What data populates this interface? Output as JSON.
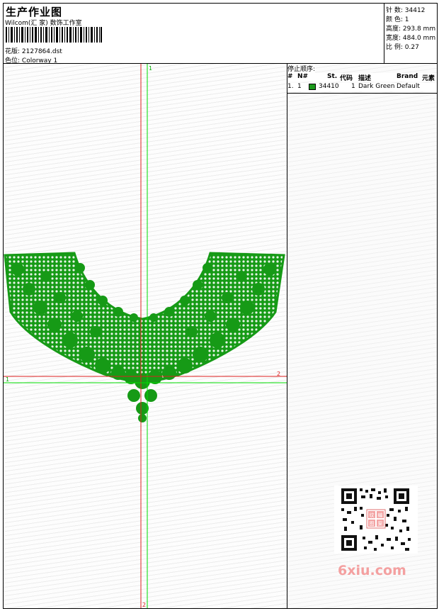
{
  "header": {
    "title": "生产作业图",
    "company": "Wilcom(汇 家) 数饰工作室",
    "design_label": "花版:",
    "design_value": "2127864.dst",
    "colorway_label": "色位:",
    "colorway_value": "Colorway 1"
  },
  "info": {
    "stitches_label": "针 数:",
    "stitches_value": "34412",
    "colors_label": "颜 色:",
    "colors_value": "1",
    "height_label": "高度:",
    "height_value": "293.8 mm",
    "width_label": "宽度:",
    "width_value": "484.0 mm",
    "scale_label": "比 例:",
    "scale_value": "0.27"
  },
  "stop_sequence": {
    "title": "停止顺序:",
    "columns": [
      "#",
      "N#",
      "St.",
      "代码",
      "描述",
      "Brand",
      "元素"
    ],
    "rows": [
      {
        "index": "1.",
        "needle": "1",
        "color": "#1c9a1c",
        "stitches": "34410",
        "code": "1",
        "description": "Dark Green",
        "brand": "Default"
      }
    ]
  },
  "canvas": {
    "marker_top": "1",
    "marker_right": "2",
    "marker_left": "1",
    "marker_bottom": "2",
    "embroidery_color": "#169a16",
    "guide_green": "#00dd00",
    "guide_red": "#dd2020"
  },
  "watermark": "6xiu.com",
  "qr_stamp": [
    "纹",
    "编",
    "图",
    "案"
  ]
}
